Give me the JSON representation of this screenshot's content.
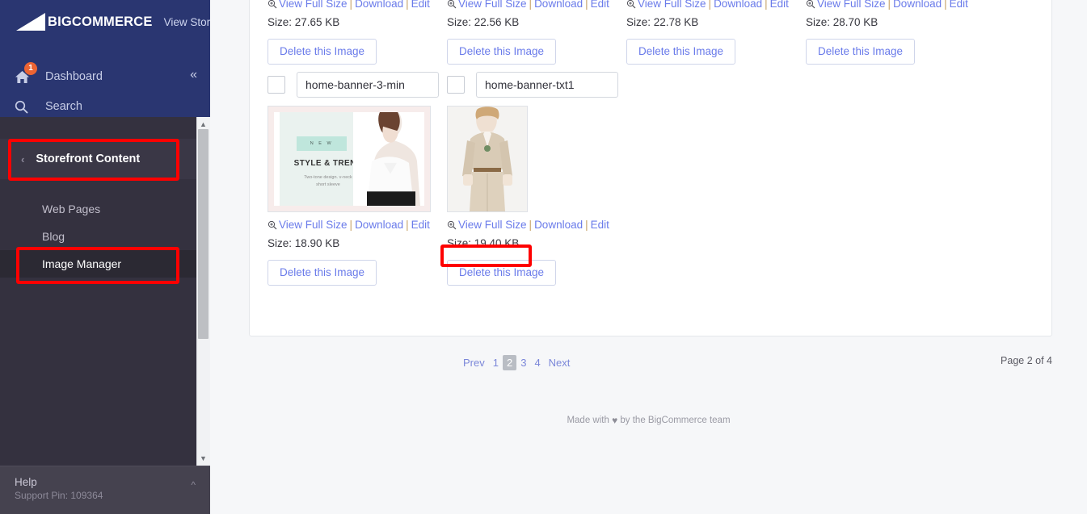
{
  "sidebar": {
    "brand": {
      "text_light": "BIG",
      "text_bold": "COMMERCE",
      "full": "BIGCOMMERCE"
    },
    "view_store": "View Store",
    "view_store_icon": "external-link-icon",
    "dashboard": {
      "label": "Dashboard",
      "icon": "home-icon",
      "badge": "1"
    },
    "search": {
      "label": "Search",
      "icon": "search-icon"
    },
    "collapse_icon": "chevron-double-left-icon",
    "section": {
      "label": "Storefront Content",
      "back_icon": "chevron-left-icon"
    },
    "items": [
      {
        "label": "Web Pages",
        "active": false
      },
      {
        "label": "Blog",
        "active": false
      },
      {
        "label": "Image Manager",
        "active": true
      }
    ],
    "help": {
      "title": "Help",
      "support_pin": "Support Pin: 109364",
      "caret_icon": "chevron-up-icon"
    },
    "scroll": {
      "up_icon": "scroll-up-arrow",
      "down_icon": "scroll-down-arrow"
    }
  },
  "main": {
    "link_labels": {
      "view": "View Full Size",
      "download": "Download",
      "edit": "Edit"
    },
    "separator": "|",
    "view_icon": "magnifier-plus-icon",
    "delete_label": "Delete this Image",
    "size_prefix": "Size: ",
    "rows": [
      {
        "partial": true,
        "cells": [
          {
            "size": "Size: 27.65 KB"
          },
          {
            "size": "Size: 22.56 KB"
          },
          {
            "size": "Size: 22.78 KB"
          },
          {
            "size": "Size: 28.70 KB"
          }
        ]
      },
      {
        "partial": false,
        "cells": [
          {
            "name": "home-banner-3-min",
            "size": "Size: 18.90 KB",
            "art": "banner"
          },
          {
            "name": "home-banner-txt1",
            "size": "Size: 19.40 KB",
            "art": "suit"
          }
        ]
      }
    ],
    "thumb_art": {
      "banner": {
        "new_tag": "N E W",
        "headline": "STYLE & TREND",
        "sub_line1": "Two-tone design. v-neck",
        "sub_line2": "short sleeve"
      }
    },
    "pagination": {
      "prev": "Prev",
      "pages": [
        "1",
        "2",
        "3",
        "4"
      ],
      "current": "2",
      "next": "Next",
      "page_of": "Page 2 of 4"
    },
    "footer": {
      "prefix": "Made with ",
      "heart": "♥",
      "suffix": " by the BigCommerce team"
    }
  },
  "annotations": {
    "highlight_color": "#fe0000",
    "boxes": [
      "storefront-content",
      "image-manager",
      "view-full-size-second-image"
    ]
  }
}
